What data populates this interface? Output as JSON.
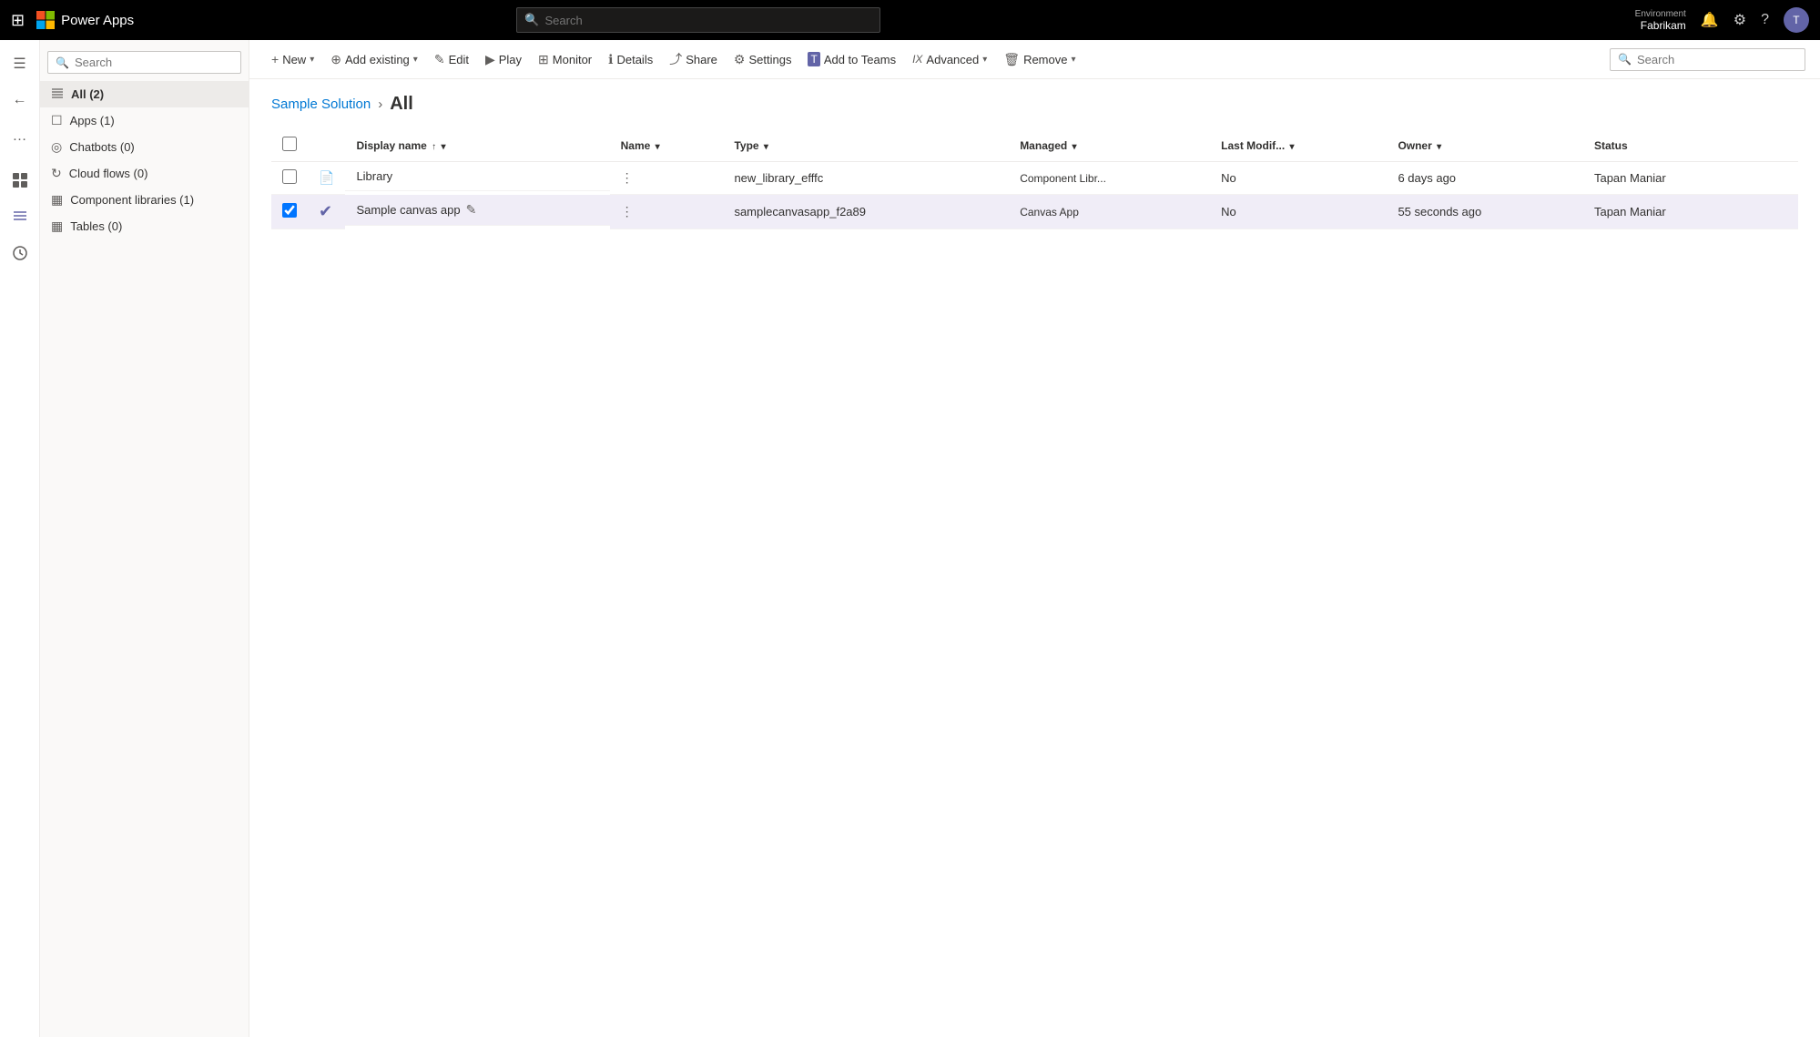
{
  "topbar": {
    "waffle_label": "⊞",
    "logo_alt": "Microsoft",
    "app_name": "Power Apps",
    "search_placeholder": "Search",
    "environment_label": "Environment",
    "environment_name": "Fabrikam",
    "avatar_initials": "T"
  },
  "rail": {
    "items": [
      {
        "id": "menu",
        "icon": "☰",
        "label": "Toggle menu"
      },
      {
        "id": "home",
        "icon": "←",
        "label": "Back"
      },
      {
        "id": "more",
        "icon": "···",
        "label": "More"
      },
      {
        "id": "apps",
        "icon": "⊡",
        "label": "Apps icon"
      },
      {
        "id": "list",
        "icon": "≡",
        "label": "Solutions list"
      },
      {
        "id": "history",
        "icon": "⏱",
        "label": "History"
      }
    ]
  },
  "sidebar": {
    "search_placeholder": "Search",
    "items": [
      {
        "id": "all",
        "label": "All  (2)",
        "icon": "≡",
        "active": true
      },
      {
        "id": "apps",
        "label": "Apps  (1)",
        "icon": "□"
      },
      {
        "id": "chatbots",
        "label": "Chatbots  (0)",
        "icon": "◎"
      },
      {
        "id": "cloud_flows",
        "label": "Cloud flows  (0)",
        "icon": "↻"
      },
      {
        "id": "component_libraries",
        "label": "Component libraries  (1)",
        "icon": "▦"
      },
      {
        "id": "tables",
        "label": "Tables  (0)",
        "icon": "▦"
      }
    ]
  },
  "toolbar": {
    "buttons": [
      {
        "id": "new",
        "icon": "+",
        "label": "New",
        "has_caret": true
      },
      {
        "id": "add_existing",
        "icon": "⊕",
        "label": "Add existing",
        "has_caret": true
      },
      {
        "id": "edit",
        "icon": "✎",
        "label": "Edit",
        "has_caret": false
      },
      {
        "id": "play",
        "icon": "▶",
        "label": "Play",
        "has_caret": false
      },
      {
        "id": "monitor",
        "icon": "⊞",
        "label": "Monitor",
        "has_caret": false
      },
      {
        "id": "details",
        "icon": "ℹ",
        "label": "Details",
        "has_caret": false
      },
      {
        "id": "share",
        "icon": "⤴",
        "label": "Share",
        "has_caret": false
      },
      {
        "id": "settings",
        "icon": "⚙",
        "label": "Settings",
        "has_caret": false
      },
      {
        "id": "add_to_teams",
        "icon": "T",
        "label": "Add to Teams",
        "has_caret": false
      },
      {
        "id": "advanced",
        "icon": "IX",
        "label": "Advanced",
        "has_caret": true
      },
      {
        "id": "remove",
        "icon": "🗑",
        "label": "Remove",
        "has_caret": true
      }
    ],
    "search_placeholder": "Search"
  },
  "breadcrumb": {
    "parent": "Sample Solution",
    "separator": ">",
    "current": "All"
  },
  "table": {
    "columns": [
      {
        "id": "display_name",
        "label": "Display name",
        "sort": "asc",
        "has_filter": true
      },
      {
        "id": "name",
        "label": "Name",
        "sort": null,
        "has_filter": true
      },
      {
        "id": "type",
        "label": "Type",
        "sort": null,
        "has_filter": true
      },
      {
        "id": "managed",
        "label": "Managed",
        "sort": null,
        "has_filter": true
      },
      {
        "id": "last_modified",
        "label": "Last Modif...",
        "sort": null,
        "has_filter": true
      },
      {
        "id": "owner",
        "label": "Owner",
        "sort": null,
        "has_filter": true
      },
      {
        "id": "status",
        "label": "Status",
        "sort": null,
        "has_filter": false
      }
    ],
    "rows": [
      {
        "id": "library",
        "selected": false,
        "icon": "📄",
        "icon_type": "library",
        "display_name": "Library",
        "name": "new_library_efffc",
        "type": "Component Libr...",
        "managed": "No",
        "last_modified": "6 days ago",
        "owner": "Tapan Maniar",
        "status": ""
      },
      {
        "id": "sample_canvas_app",
        "selected": true,
        "icon": "✔",
        "icon_type": "canvas_selected",
        "display_name": "Sample canvas app",
        "name": "samplecanvasapp_f2a89",
        "type": "Canvas App",
        "managed": "No",
        "last_modified": "55 seconds ago",
        "owner": "Tapan Maniar",
        "status": ""
      }
    ]
  }
}
